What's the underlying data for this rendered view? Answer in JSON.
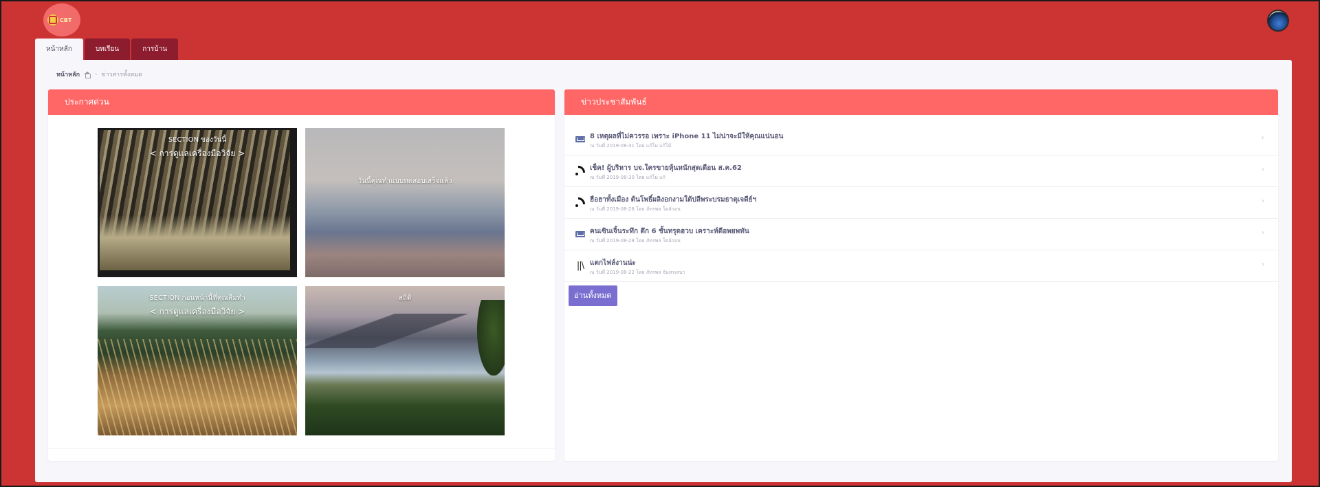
{
  "brand": {
    "logo_text": "CBT"
  },
  "tabs": [
    {
      "label": "หน้าหลัก",
      "active": true
    },
    {
      "label": "บทเรียน",
      "active": false
    },
    {
      "label": "การบ้าน",
      "active": false
    }
  ],
  "breadcrumb": {
    "home": "หน้าหลัก",
    "current": "ข่าวสารทั้งหมด"
  },
  "announcements": {
    "title": "ประกาศด่วน",
    "tiles": [
      {
        "line1": "SECTION ของวันนี้",
        "line2": "< การดูแลเครื่องมือวิจัย >"
      },
      {
        "line1": "วันนี้คุณทำแบบทดสอบเสร็จแล้ว"
      },
      {
        "line1": "SECTION ก่อนหน้านี้ที่คุณลืมทำ",
        "line2": "< การดูแลเครื่องมือวิจัย >"
      },
      {
        "line1": "สถิติ"
      }
    ]
  },
  "news": {
    "title": "ข่าวประชาสัมพันธ์",
    "items": [
      {
        "icon": "mail-icon",
        "title": "8 เหตุผลที่ไม่ควรรอ เพราะ iPhone 11 ไม่น่าจะมีให้คุณแน่นอน",
        "meta": "ณ วันที่ 2019-08-31 โดย แก้โม แก้โม้"
      },
      {
        "icon": "rss-icon",
        "title": "เช็ค! ผู้บริหาร บจ.ใครขายหุ้นหนักสุดเดือน ส.ค.62",
        "meta": "ณ วันที่ 2019-08-30 โดย แก้โม แก้"
      },
      {
        "icon": "rss-icon",
        "title": "ฮือฮาทั้งเมือง ต้นโพธิ์ผลิงอกงามใต้ปลีพระบรมธาตุเจดีย์ฯ",
        "meta": "ณ วันที่ 2019-08-28 โดย ภัทรพล โตลักอน"
      },
      {
        "icon": "mail-icon",
        "title": "คนเซินเจิ้นระทึก ตึก 6 ชั้นทรุดฮวบ เคราะห์ดีอพยพทัน",
        "meta": "ณ วันที่ 2019-08-28 โดย ภัทรพล โตลักอน"
      },
      {
        "icon": "books-icon",
        "title": "แตกไฟล์งานน่ะ",
        "meta": "ณ วันที่ 2019-08-22 โดย ภัทรพล จันทรเสนา"
      }
    ],
    "read_all_label": "อ่านทั้งหมด",
    "chevron": "›"
  },
  "colors": {
    "background": "#cc3333",
    "header_bar": "#ff6666",
    "tab_dark": "#8e1c2f",
    "button": "#7a6fd0"
  }
}
